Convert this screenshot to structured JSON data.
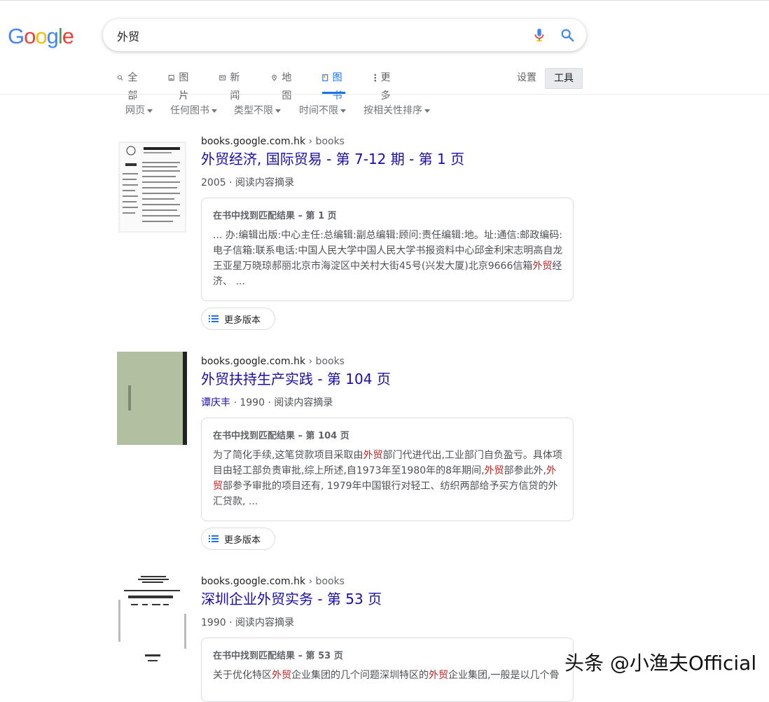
{
  "logo": {
    "letters": [
      "G",
      "o",
      "o",
      "g",
      "l",
      "e"
    ],
    "colors": [
      "#4285f4",
      "#ea4335",
      "#fbbc05",
      "#4285f4",
      "#34a853",
      "#ea4335"
    ]
  },
  "search": {
    "query": "外贸"
  },
  "tabs": [
    {
      "label": "全部",
      "icon": "search-icon"
    },
    {
      "label": "图片",
      "icon": "image-icon"
    },
    {
      "label": "新闻",
      "icon": "news-icon"
    },
    {
      "label": "地图",
      "icon": "map-pin-icon"
    },
    {
      "label": "图书",
      "icon": "book-icon",
      "active": true
    },
    {
      "label": "更多",
      "icon": "more-vert-icon"
    }
  ],
  "settings_label": "设置",
  "tools_label": "工具",
  "filters": [
    "网页",
    "任何图书",
    "类型不限",
    "时间不限",
    "按相关性排序"
  ],
  "results": [
    {
      "cite_domain": "books.google.com.hk",
      "cite_path": " › books",
      "title": "外贸经济, 国际贸易 - 第 7-12 期 - 第 1 页",
      "meta_author": "",
      "meta_rest": "2005 · 阅读内容摘录",
      "snippet_head": "在书中找到匹配结果 – 第 1 页",
      "snippet_parts": [
        {
          "t": "... 办:编辑出版:中心主任:总编辑:副总编辑:顾问:责任编辑:地。址:通信:邮政编码:电子信箱:联系电话:中国人民大学中国人民大学书报资料中心邱金利宋志明高自龙王亚星万晓琼郝丽北京市海淀区中关村大街45号(兴发大厦)北京9666信箱"
        },
        {
          "t": "外贸",
          "hl": true
        },
        {
          "t": "经济、 ..."
        }
      ],
      "more_label": "更多版本"
    },
    {
      "cite_domain": "books.google.com.hk",
      "cite_path": " › books",
      "title": "外贸扶持生产实践 - 第 104 页",
      "meta_author": "谭庆丰",
      "meta_rest": " · 1990 · 阅读内容摘录",
      "snippet_head": "在书中找到匹配结果 – 第 104 页",
      "snippet_parts": [
        {
          "t": "为了简化手续,这笔贷款项目采取由"
        },
        {
          "t": "外贸",
          "hl": true
        },
        {
          "t": "部门代进代出,工业部门自负盈亏。具体项目由轻工部负责审批,综上所述,自1973年至1980年的8年期间,"
        },
        {
          "t": "外贸",
          "hl": true
        },
        {
          "t": "部参此外,"
        },
        {
          "t": "外贸",
          "hl": true
        },
        {
          "t": "部参予审批的项目还有, 1979年中国银行对轻工、纺织两部给予买方信贷的外汇贷款, ..."
        }
      ],
      "more_label": "更多版本"
    },
    {
      "cite_domain": "books.google.com.hk",
      "cite_path": " › books",
      "title": "深圳企业外贸实务 - 第 53 页",
      "meta_author": "",
      "meta_rest": "1990 · 阅读内容摘录",
      "snippet_head": "在书中找到匹配结果 – 第 53 页",
      "snippet_parts": [
        {
          "t": "关于优化特区"
        },
        {
          "t": "外贸",
          "hl": true
        },
        {
          "t": "企业集团的几个问题深圳特区的"
        },
        {
          "t": "外贸",
          "hl": true
        },
        {
          "t": "企业集团,一般是以几个骨"
        }
      ],
      "more_label": ""
    }
  ],
  "watermark": "头条 @小渔夫Official"
}
